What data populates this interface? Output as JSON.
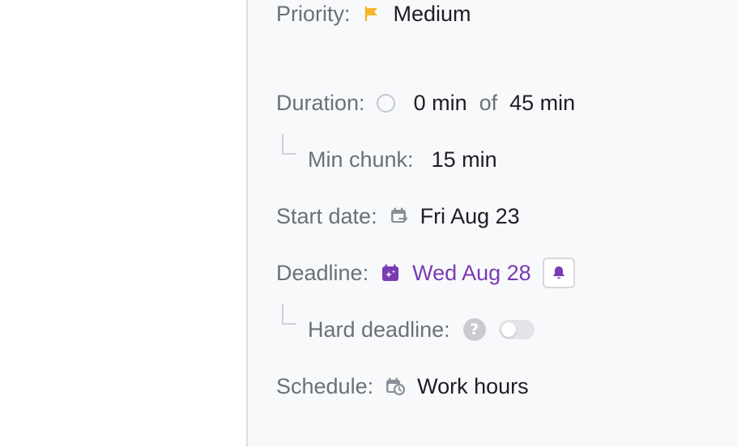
{
  "priority": {
    "label": "Priority:",
    "value": "Medium",
    "icon": "flag-icon",
    "color": "#f5b52a"
  },
  "duration": {
    "label": "Duration:",
    "spent": "0 min",
    "of": "of",
    "total": "45 min",
    "icon": "progress-ring-icon"
  },
  "min_chunk": {
    "label": "Min chunk:",
    "value": "15 min"
  },
  "start_date": {
    "label": "Start date:",
    "value": "Fri Aug 23",
    "icon": "calendar-arrow-icon"
  },
  "deadline": {
    "label": "Deadline:",
    "value": "Wed Aug 28",
    "icon": "calendar-sparkle-icon",
    "color": "#7a3bb3",
    "reminder_icon": "bell-icon"
  },
  "hard_deadline": {
    "label": "Hard deadline:",
    "help_icon": "question-icon",
    "help_glyph": "?",
    "toggle_on": false
  },
  "schedule": {
    "label": "Schedule:",
    "value": "Work hours",
    "icon": "calendar-clock-icon"
  }
}
